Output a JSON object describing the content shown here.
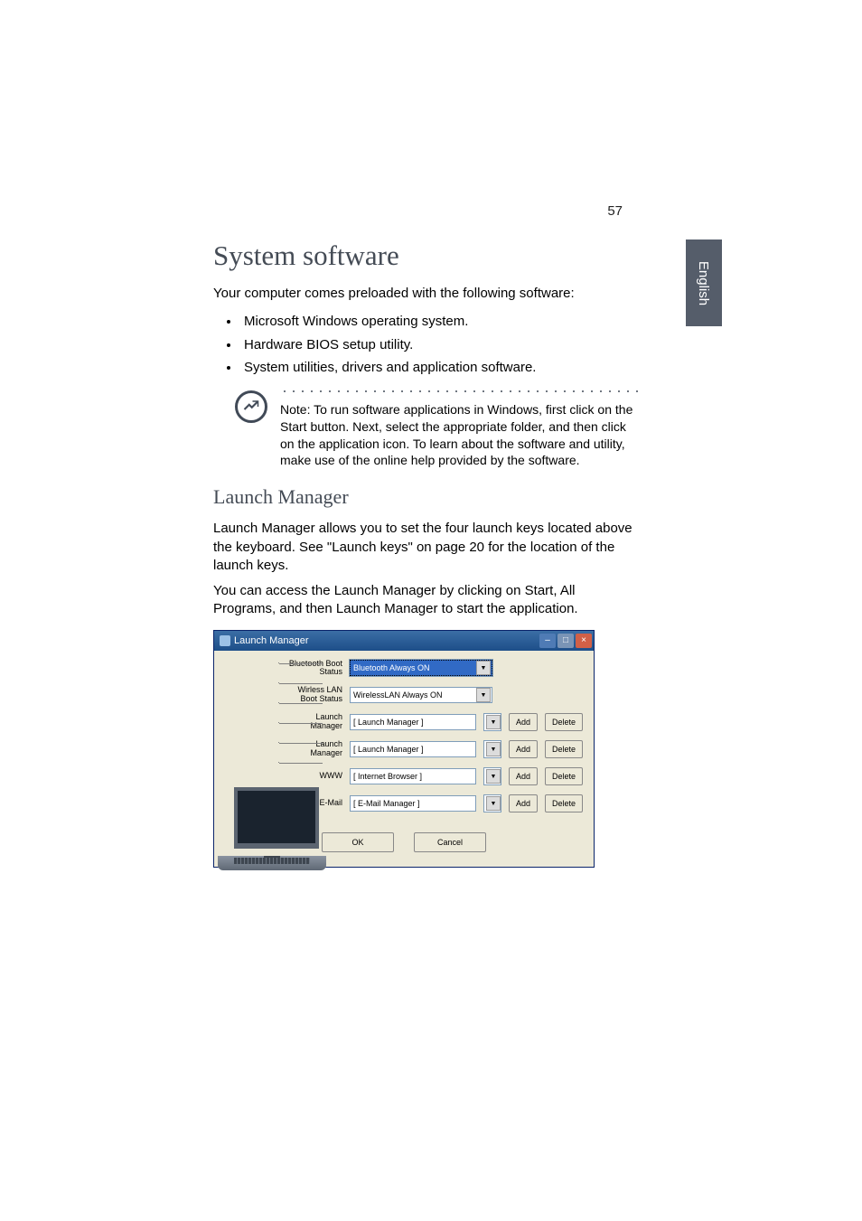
{
  "page_number": "57",
  "language_tab": "English",
  "h1": "System software",
  "intro": "Your computer comes preloaded with the following software:",
  "bullets": [
    "Microsoft Windows operating system.",
    "Hardware BIOS setup utility.",
    "System utilities, drivers and application software."
  ],
  "note": "Note: To run software applications in Windows, first click on the Start button. Next, select the appropriate folder, and then click on the application icon. To learn about the software and utility, make use of the online help provided by the software.",
  "h2": "Launch Manager",
  "p1": "Launch Manager allows you to set the four launch keys located above the keyboard.  See \"Launch keys\" on page 20 for the location of the launch keys.",
  "p2": "You can access the Launch Manager by clicking on Start, All Programs, and then Launch Manager to start the application.",
  "lm": {
    "title": "Launch Manager",
    "rows": [
      {
        "label": "Bluetooth Boot Status",
        "value": "Bluetooth Always ON",
        "type": "select_hl",
        "add": "",
        "del": ""
      },
      {
        "label": "Wirless LAN Boot Status",
        "value": "WirelessLAN Always ON",
        "type": "select",
        "add": "",
        "del": ""
      },
      {
        "label": "Launch Manager",
        "value": "[  Launch Manager  ]",
        "type": "input",
        "add": "Add",
        "del": "Delete"
      },
      {
        "label": "Launch Manager",
        "value": "[  Launch Manager  ]",
        "type": "input",
        "add": "Add",
        "del": "Delete"
      },
      {
        "label": "WWW",
        "value": "[  Internet Browser  ]",
        "type": "input",
        "add": "Add",
        "del": "Delete"
      },
      {
        "label": "E-Mail",
        "value": "[  E-Mail Manager  ]",
        "type": "input",
        "add": "Add",
        "del": "Delete"
      }
    ],
    "ok": "OK",
    "cancel": "Cancel"
  }
}
